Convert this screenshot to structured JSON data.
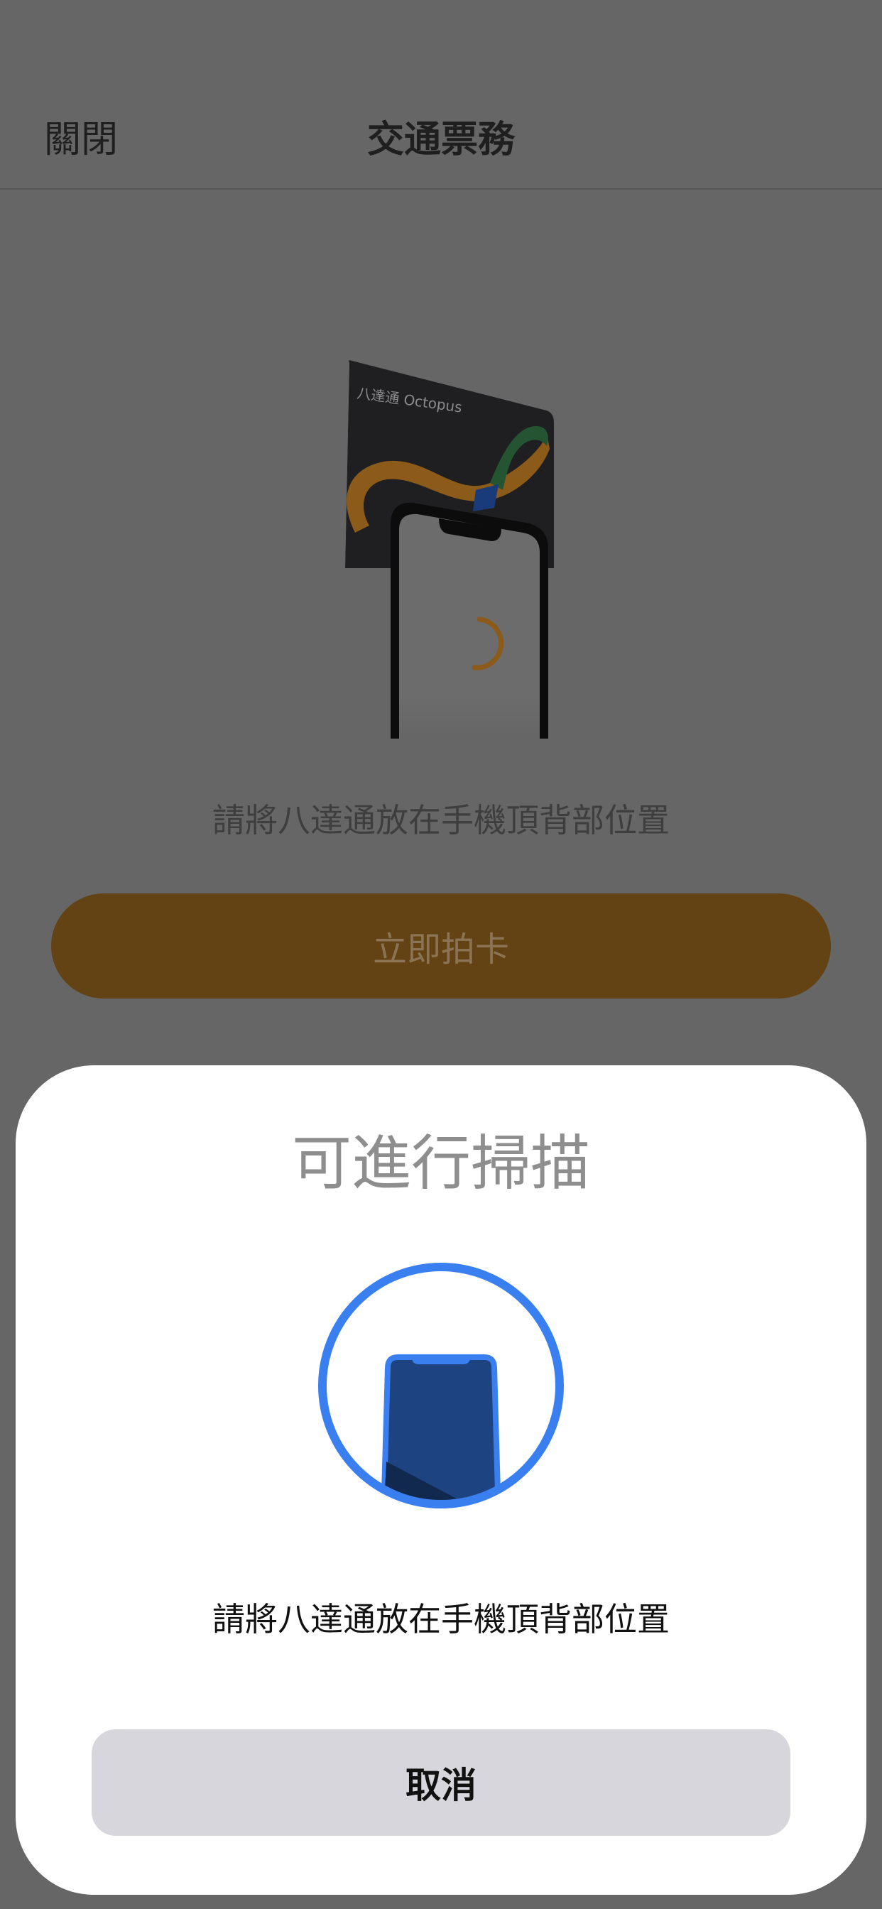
{
  "header": {
    "close_label": "關閉",
    "title": "交通票務"
  },
  "illustration": {
    "card_label": "八達通 Octopus"
  },
  "main": {
    "instruction": "請將八達通放在手機頂背部位置",
    "tap_button_label": "立即拍卡",
    "tap_button_color": "#634213"
  },
  "scan_sheet": {
    "title": "可進行掃描",
    "instruction": "請將八達通放在手機頂背部位置",
    "cancel_label": "取消",
    "accent_color": "#3a7ff0"
  }
}
